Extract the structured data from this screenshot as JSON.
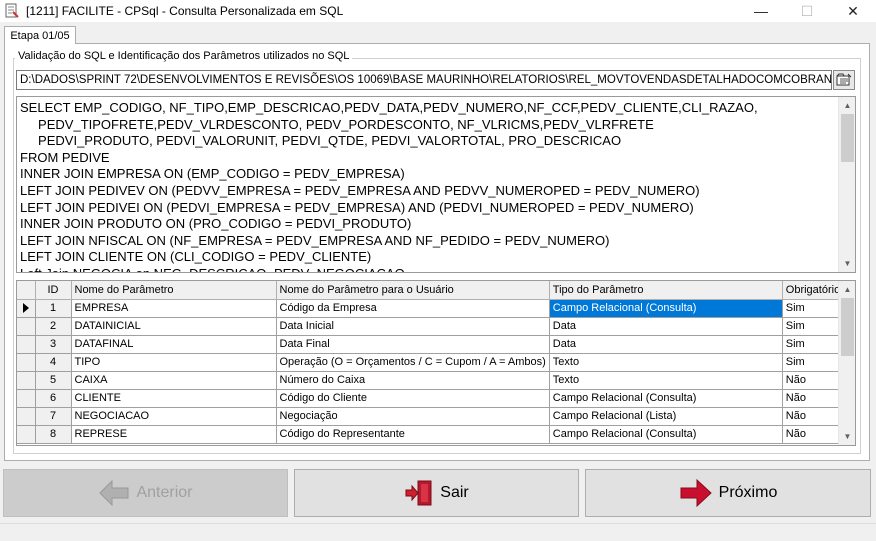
{
  "window": {
    "title": "[1211] FACILITE - CPSql - Consulta Personalizada em SQL",
    "min_glyph": "—",
    "max_glyph": "☐",
    "close_glyph": "✕"
  },
  "tab": {
    "label": "Etapa 01/05"
  },
  "group": {
    "legend": "Validação do SQL e Identificação dos Parâmetros utilizados no SQL"
  },
  "path_field": {
    "value": "D:\\DADOS\\SPRINT 72\\DESENVOLVIMENTOS E REVISÕES\\OS 10069\\BASE MAURINHO\\RELATORIOS\\REL_MOVTOVENDASDETALHADOCOMCOBRANCAEVEN"
  },
  "sql": {
    "lines": [
      "SELECT EMP_CODIGO, NF_TIPO,EMP_DESCRICAO,PEDV_DATA,PEDV_NUMERO,NF_CCF,PEDV_CLIENTE,CLI_RAZAO,",
      "     PEDV_TIPOFRETE,PEDV_VLRDESCONTO, PEDV_PORDESCONTO, NF_VLRICMS,PEDV_VLRFRETE",
      "     PEDVI_PRODUTO, PEDVI_VALORUNIT, PEDVI_QTDE, PEDVI_VALORTOTAL, PRO_DESCRICAO",
      "FROM PEDIVE",
      "INNER JOIN EMPRESA ON (EMP_CODIGO = PEDV_EMPRESA)",
      "LEFT JOIN PEDIVEV ON (PEDVV_EMPRESA = PEDV_EMPRESA AND PEDVV_NUMEROPED = PEDV_NUMERO)",
      "LEFT JOIN PEDIVEI ON (PEDVI_EMPRESA = PEDV_EMPRESA) AND (PEDVI_NUMEROPED = PEDV_NUMERO)",
      "INNER JOIN PRODUTO ON (PRO_CODIGO = PEDVI_PRODUTO)",
      "LEFT JOIN NFISCAL ON (NF_EMPRESA = PEDV_EMPRESA AND NF_PEDIDO = PEDV_NUMERO)",
      "LEFT JOIN CLIENTE ON (CLI_CODIGO = PEDV_CLIENTE)",
      "Left Join NEGOCIA on NEG_DESCRICAO=PEDV_NEGOCIACAO"
    ]
  },
  "grid": {
    "headers": [
      "ID",
      "Nome do Parâmetro",
      "Nome do Parâmetro para o Usuário",
      "Tipo do Parâmetro",
      "Obrigatório?"
    ],
    "rows": [
      [
        "1",
        "EMPRESA",
        "Código da Empresa",
        "Campo Relacional (Consulta)",
        "Sim"
      ],
      [
        "2",
        "DATAINICIAL",
        "Data Inicial",
        "Data",
        "Sim"
      ],
      [
        "3",
        "DATAFINAL",
        "Data Final",
        "Data",
        "Sim"
      ],
      [
        "4",
        "TIPO",
        "Operação (O = Orçamentos / C = Cupom / A = Ambos)",
        "Texto",
        "Sim"
      ],
      [
        "5",
        "CAIXA",
        "Número do Caixa",
        "Texto",
        "Não"
      ],
      [
        "6",
        "CLIENTE",
        "Código do Cliente",
        "Campo Relacional (Consulta)",
        "Não"
      ],
      [
        "7",
        "NEGOCIACAO",
        "Negociação",
        "Campo Relacional (Lista)",
        "Não"
      ],
      [
        "8",
        "REPRESE",
        "Código do Representante",
        "Campo Relacional (Consulta)",
        "Não"
      ]
    ],
    "selected_row": 0,
    "accent": "#0078d7"
  },
  "buttons": {
    "prev": "Anterior",
    "exit": "Sair",
    "next": "Próximo"
  },
  "colors": {
    "exit_icon": "#c8102e",
    "next_arrow": "#c8102e",
    "prev_arrow_disabled": "#a8a8a8"
  }
}
